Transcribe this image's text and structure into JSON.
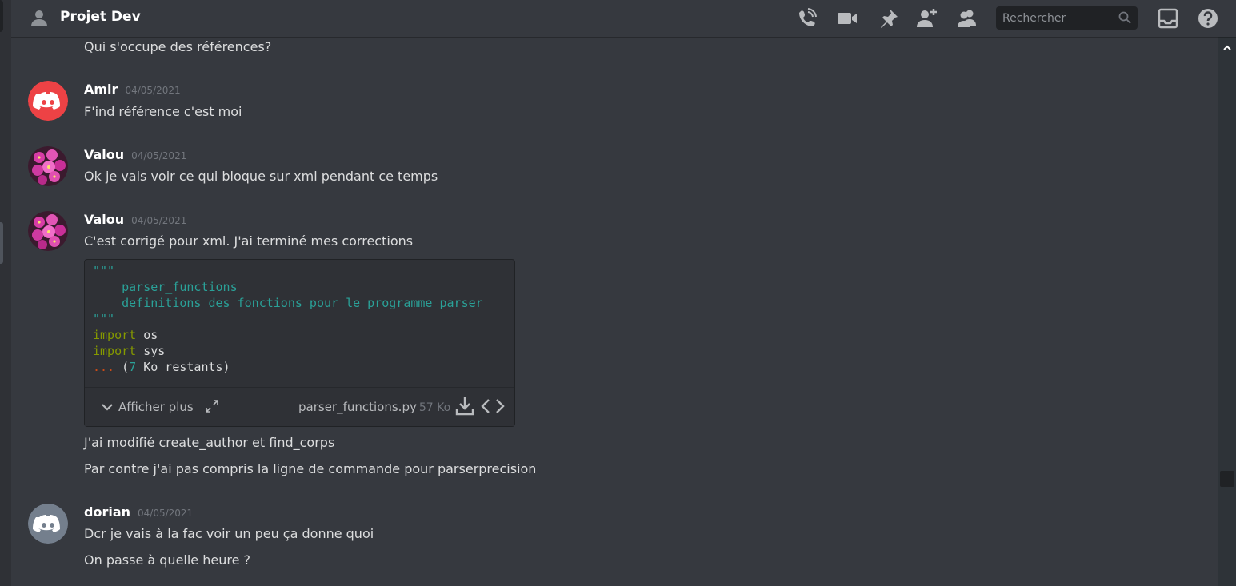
{
  "header": {
    "channel_title": "Projet Dev",
    "search_placeholder": "Rechercher",
    "icons": [
      "channel-members-icon",
      "voice-call-icon",
      "video-call-icon",
      "pin-icon",
      "add-friend-icon",
      "member-list-icon",
      "search-icon",
      "inbox-icon",
      "help-icon"
    ]
  },
  "messages": {
    "prev_line": "Qui s'occupe des références?",
    "m1": {
      "author": "Amir",
      "timestamp": "04/05/2021",
      "lines": [
        "F'ind référence c'est moi"
      ]
    },
    "m2": {
      "author": "Valou",
      "timestamp": "04/05/2021",
      "lines": [
        "Ok je vais voir ce qui bloque sur xml pendant ce temps"
      ]
    },
    "m3": {
      "author": "Valou",
      "timestamp": "04/05/2021",
      "lines": [
        "C'est corrigé pour xml. J'ai terminé mes corrections",
        "J'ai modifié create_author et find_corps",
        "Par contre j'ai pas compris la ligne de commande pour parserprecision"
      ],
      "attachment": {
        "code": {
          "quote_open": "\"\"\"",
          "doc_line1": "parser_functions",
          "doc_line2": "definitions des fonctions pour le programme parser",
          "quote_close": "\"\"\"",
          "kw1": "import",
          "mod1": " os",
          "kw2": "import",
          "mod2": " sys",
          "dots": "...",
          "rest_open": " (",
          "rest_num": "7",
          "rest_text": " Ko restants)"
        },
        "show_more": "Afficher plus",
        "filename": "parser_functions.py",
        "filesize": "57 Ko"
      }
    },
    "m4": {
      "author": "dorian",
      "timestamp": "04/05/2021",
      "lines": [
        "Dcr je vais à la fac voir un peu ça donne quoi",
        "On passe à quelle heure ?"
      ]
    }
  },
  "colors": {
    "background": "#36393f",
    "amir_avatar": "#ed4245",
    "dorian_avatar": "#747f8d",
    "code_string": "#2aa198",
    "code_keyword": "#859900"
  }
}
